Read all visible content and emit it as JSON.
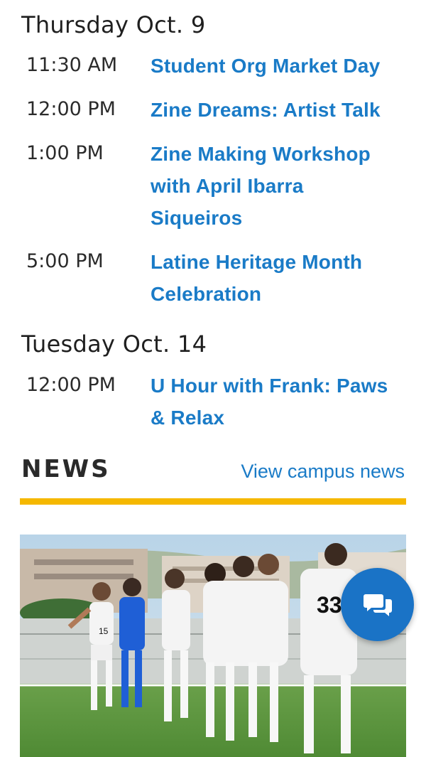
{
  "events": {
    "day1": {
      "heading": "Thursday Oct. 9",
      "items": [
        {
          "time": "11:30 AM",
          "title": "Student Org Market Day"
        },
        {
          "time": "12:00 PM",
          "title": "Zine Dreams: Artist Talk"
        },
        {
          "time": "1:00 PM",
          "title": "Zine Making Workshop with April Ibarra Siqueiros"
        },
        {
          "time": "5:00 PM",
          "title": "Latine Heritage Month Celebration"
        }
      ]
    },
    "day2": {
      "heading": "Tuesday Oct. 14",
      "items": [
        {
          "time": "12:00 PM",
          "title": "U Hour with Frank: Paws & Relax"
        }
      ]
    }
  },
  "news": {
    "title": "NEWS",
    "link": "View campus news",
    "accent_color": "#f5b800",
    "image_jerseys": [
      "15",
      "33"
    ]
  },
  "chat": {
    "icon": "chat-bubbles-icon",
    "color": "#1a73c6"
  }
}
